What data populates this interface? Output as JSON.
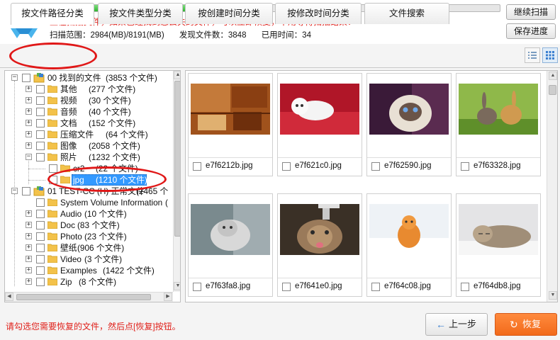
{
  "header": {
    "scan_progress": 0.365,
    "scan_message": "正在扫描文件，如果已经找到您丢失的文件，可以立即恢复，不用等待扫描结束！",
    "stats": {
      "scan_range": "扫描范围：2984(MB)/8191(MB)",
      "found_count": "发现文件数：3848",
      "elapsed": "已用时间：34"
    },
    "continue_label": "继续扫描",
    "save_label": "保存进度"
  },
  "tabs": [
    {
      "label": "按文件路径分类",
      "active": true
    },
    {
      "label": "按文件类型分类",
      "active": false
    },
    {
      "label": "按创建时间分类",
      "active": false
    },
    {
      "label": "按修改时间分类",
      "active": false
    },
    {
      "label": "文件搜索",
      "active": false
    }
  ],
  "tree": {
    "root1": {
      "label": "00 找到的文件",
      "count": "(3853 个文件)"
    },
    "items": [
      {
        "label": "其他",
        "count": "(277 个文件)"
      },
      {
        "label": "视频",
        "count": "(30 个文件)"
      },
      {
        "label": "音频",
        "count": "(40 个文件)"
      },
      {
        "label": "文档",
        "count": "(152 个文件)"
      },
      {
        "label": "压缩文件",
        "count": "(64 个文件)"
      },
      {
        "label": "图像",
        "count": "(2058 个文件)"
      },
      {
        "label": "照片",
        "count": "(1232 个文件)"
      }
    ],
    "sub_cr2": {
      "label": "cr2",
      "count": "(22 个文件)"
    },
    "sub_jpg": {
      "label": "jpg",
      "count": "(1210 个文件)"
    },
    "root2": {
      "label": "01 TEST-CC (H) 正常文件",
      "count": "(2465 个"
    },
    "items2": [
      {
        "label": "System Volume Information",
        "count": "("
      },
      {
        "label": "Audio",
        "count": "(10 个文件)"
      },
      {
        "label": "Doc",
        "count": "(83 个文件)"
      },
      {
        "label": "Photo",
        "count": "(23 个文件)"
      },
      {
        "label": "壁纸",
        "count": "(906 个文件)"
      },
      {
        "label": "Video",
        "count": "(3 个文件)"
      },
      {
        "label": "Examples",
        "count": "(1422 个文件)"
      },
      {
        "label": "Zip",
        "count": "(8 个文件)"
      }
    ]
  },
  "files": [
    {
      "name": "e7f6212b.jpg",
      "scene": "wooden-room"
    },
    {
      "name": "e7f621c0.jpg",
      "scene": "white-kitten-red-cloth"
    },
    {
      "name": "e7f62590.jpg",
      "scene": "himalayan-cat"
    },
    {
      "name": "e7f63328.jpg",
      "scene": "two-rabbits-grass"
    },
    {
      "name": "e7f63fa8.jpg",
      "scene": "grey-kitten"
    },
    {
      "name": "e7f641e0.jpg",
      "scene": "cat-drinking-faucet"
    },
    {
      "name": "e7f64c08.jpg",
      "scene": "orange-kitten-snow"
    },
    {
      "name": "e7f64db8.jpg",
      "scene": "tabby-cat-sleeping"
    }
  ],
  "footer": {
    "hint": "请勾选您需要恢复的文件，然后点[恢复]按钮。",
    "prev_label": "上一步",
    "recover_label": "恢复"
  },
  "colors": {
    "accent_red": "#e0201a",
    "recover_orange": "#f26a1b",
    "progress_green": "#2fb52f"
  }
}
